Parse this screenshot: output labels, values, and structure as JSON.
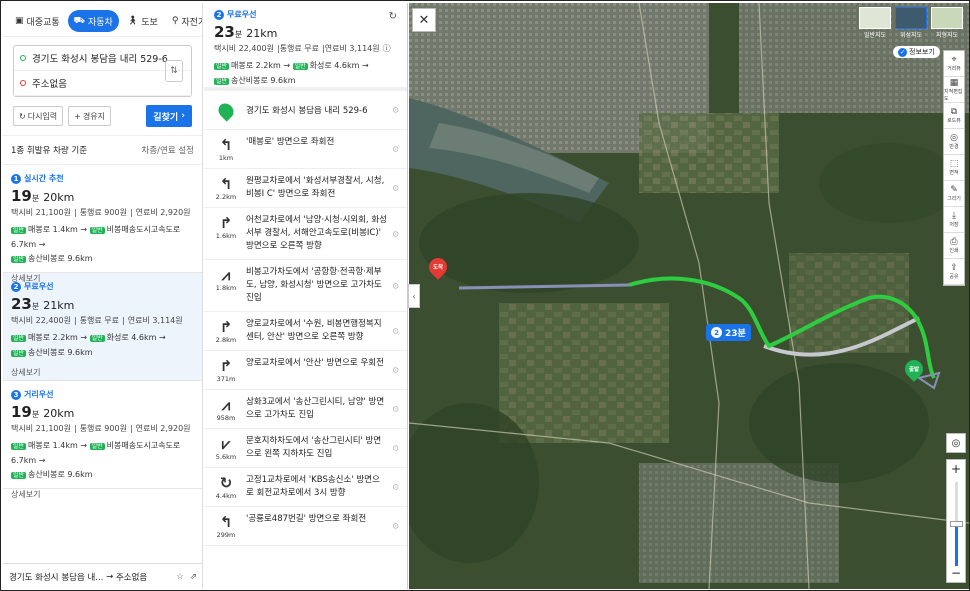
{
  "tabs": [
    {
      "label": "대중교통",
      "icon": "bus-icon"
    },
    {
      "label": "자동차",
      "icon": "car-icon"
    },
    {
      "label": "도보",
      "icon": "walk-icon"
    },
    {
      "label": "자전거",
      "icon": "bike-icon"
    }
  ],
  "search": {
    "origin": "경기도 화성시 봉담읍 내리 529-6",
    "destination": "주소없음"
  },
  "buttons": {
    "reset": "다시입력",
    "waypoint": "경유지",
    "find": "길찾기"
  },
  "sort": {
    "basis": "1종 휘발유 차량 기준",
    "settings": "차종/연료 설정"
  },
  "routes": [
    {
      "num": "1",
      "label": "실시간 추천",
      "time": "19",
      "unit": "분",
      "dist": "20km",
      "taxi": "택시비 21,100원",
      "toll": "통행료 900원",
      "fuel": "연료비 2,920원",
      "roads": [
        {
          "a": "매봉로 1.4km",
          "b": "비봉매송도시고속도로 6.7km"
        },
        {
          "a": "송산비봉로 9.6km",
          "b": ""
        }
      ],
      "detail": "상세보기"
    },
    {
      "num": "2",
      "label": "무료우선",
      "time": "23",
      "unit": "분",
      "dist": "21km",
      "taxi": "택시비 22,400원",
      "toll": "통행료 무료",
      "fuel": "연료비 3,114원",
      "roads": [
        {
          "a": "매봉로 2.2km",
          "b": "화성로 4.6km"
        },
        {
          "a": "송산비봉로 9.6km",
          "b": ""
        }
      ],
      "detail": "상세보기"
    },
    {
      "num": "3",
      "label": "거리우선",
      "time": "19",
      "unit": "분",
      "dist": "20km",
      "taxi": "택시비 21,100원",
      "toll": "통행료 900원",
      "fuel": "연료비 2,920원",
      "roads": [
        {
          "a": "매봉로 1.4km",
          "b": "비봉매송도시고속도로 6.7km"
        },
        {
          "a": "송산비봉로 9.6km",
          "b": ""
        }
      ],
      "detail": "상세보기"
    }
  ],
  "tag_label": "일반",
  "footer": {
    "text": "경기도 화성시 봉담읍 내...",
    "arrow": "→",
    "dest": "주소없음"
  },
  "detail_header": {
    "num": "2",
    "label": "무료우선",
    "time": "23",
    "unit": "분",
    "dist": "21km",
    "taxi": "택시비 22,400원",
    "toll": "통행료 무료",
    "fuel": "연료비 3,114원",
    "roads": [
      {
        "a": "매봉로 2.2km",
        "b": "화성로 4.6km"
      },
      {
        "a": "송산비봉로 9.6km",
        "b": ""
      }
    ]
  },
  "steps": [
    {
      "glyph": "start",
      "dist": "",
      "text": "경기도 화성시 봉담읍 내리 529-6",
      "pin_label": "출발"
    },
    {
      "glyph": "↰",
      "dist": "1km",
      "text": "'매봉로' 방면으로 좌회전"
    },
    {
      "glyph": "↰",
      "dist": "2.2km",
      "text": "원평교차로에서 '화성서부경찰서, 시청, 비봉I C' 방면으로 좌회전"
    },
    {
      "glyph": "↱",
      "dist": "1.6km",
      "text": "어천교차로에서 '남양·시청·시외회, 화성서부 경찰서, 서해안고속도로(비봉IC)' 방면으로 오른쪽 방향"
    },
    {
      "glyph": "⩘",
      "dist": "1.8km",
      "text": "비봉고가차도에서 '공항항·전곡항·제부도, 남양, 화성시청' 방면으로 고가차도 진입"
    },
    {
      "glyph": "↱",
      "dist": "2.8km",
      "text": "양로교차로에서 '수원, 비봉면행정복지센터, 안산' 방면으로 오른쪽 방향"
    },
    {
      "glyph": "↱",
      "dist": "371m",
      "text": "양로교차로에서 '안산' 방면으로 우회전"
    },
    {
      "glyph": "⩘",
      "dist": "958m",
      "text": "삼화3교에서 '송산그린시티, 남양' 방면으로 고가차도 진입"
    },
    {
      "glyph": "⩗",
      "dist": "5.6km",
      "text": "문호지하차도에서 '송산그린시티' 방면으로 왼쪽 지하차도 진입"
    },
    {
      "glyph": "↻",
      "dist": "4.4km",
      "text": "고정1교차로에서 'KBS송신소' 방면으로 회전교차로에서 3시 방향"
    },
    {
      "glyph": "↰",
      "dist": "299m",
      "text": "'공룡로487번길' 방면으로 좌회전"
    }
  ],
  "map": {
    "close": "✕",
    "types": [
      "일반지도",
      "위성지도",
      "지형지도"
    ],
    "info": "정보보기",
    "tools": [
      {
        "glyph": "⌖",
        "label": "거리뷰"
      },
      {
        "glyph": "▦",
        "label": "지적편집도"
      },
      {
        "glyph": "⧉",
        "label": "로드뷰"
      },
      {
        "glyph": "◎",
        "label": "반경"
      },
      {
        "glyph": "⬚",
        "label": "면적"
      },
      {
        "glyph": "✎",
        "label": "그리기"
      },
      {
        "glyph": "⤓",
        "label": "저장"
      },
      {
        "glyph": "⎙",
        "label": "인쇄"
      },
      {
        "glyph": "⇪",
        "label": "공유"
      }
    ],
    "badge_num": "2",
    "badge_time": "23분",
    "dest_pin": "도착",
    "start_pin": "출발",
    "zoom_in": "+",
    "zoom_out": "−",
    "zoom_level": 0.5,
    "colors": {
      "route_active": "#2ecc40",
      "route_alt": "#c8c8d0",
      "route_alt2": "#8a8fb8",
      "accent": "#1a73e8"
    }
  }
}
